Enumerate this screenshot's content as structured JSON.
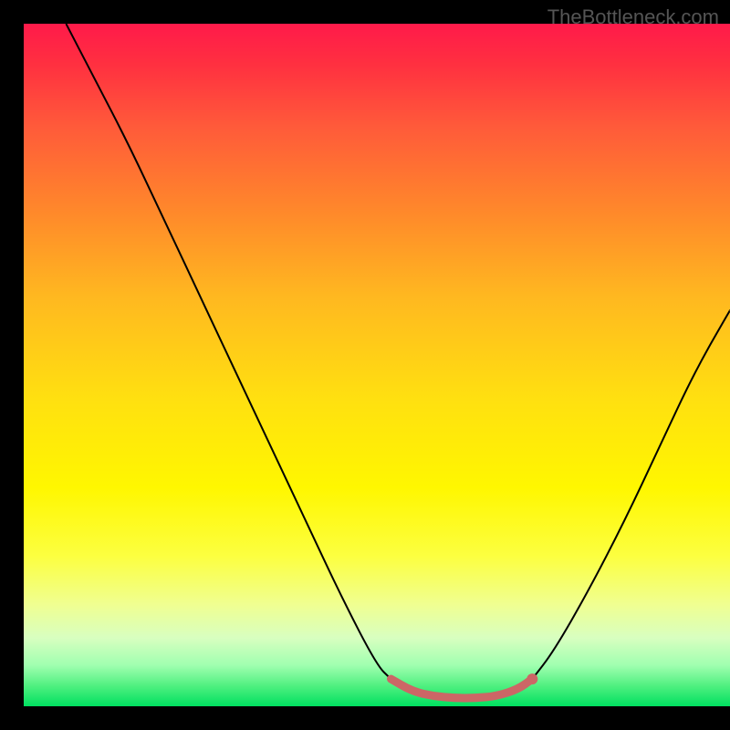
{
  "watermark": "TheBottleneck.com",
  "chart_data": {
    "type": "line",
    "title": "",
    "xlabel": "",
    "ylabel": "",
    "xlim": [
      0,
      100
    ],
    "ylim": [
      0,
      100
    ],
    "grid": false,
    "legend": false,
    "background": "heat-gradient-red-to-green",
    "series": [
      {
        "name": "left-branch",
        "x": [
          6,
          10,
          15,
          20,
          25,
          30,
          35,
          40,
          45,
          50,
          52
        ],
        "y": [
          100,
          92,
          82,
          71,
          60,
          49,
          38,
          27,
          16,
          6,
          4
        ]
      },
      {
        "name": "right-branch",
        "x": [
          72,
          75,
          80,
          85,
          90,
          95,
          100
        ],
        "y": [
          4,
          8,
          17,
          27,
          38,
          49,
          58
        ]
      },
      {
        "name": "trough-highlight",
        "x": [
          52,
          55,
          58,
          61,
          64,
          67,
          70,
          72
        ],
        "y": [
          4,
          2.2,
          1.5,
          1.2,
          1.2,
          1.5,
          2.5,
          4
        ]
      }
    ],
    "marker_dot": {
      "x": 72,
      "y": 4
    },
    "colors": {
      "curve": "#000000",
      "trough": "#cc6666"
    }
  }
}
